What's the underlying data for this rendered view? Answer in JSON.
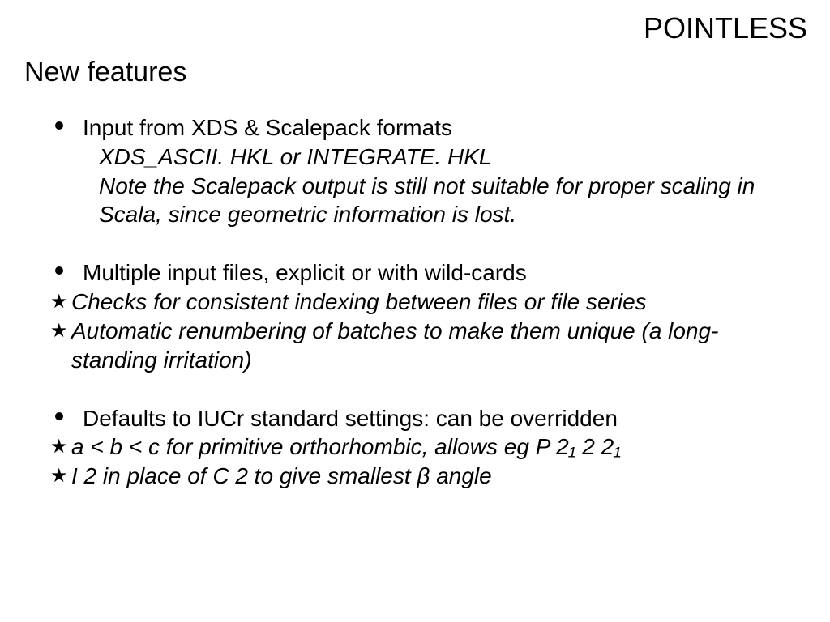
{
  "header": {
    "title_right": "POINTLESS",
    "subtitle": "New features"
  },
  "blocks": [
    {
      "bullet": "Input from XDS & Scalepack formats",
      "indented": [
        "XDS_ASCII. HKL or INTEGRATE. HKL",
        "Note the Scalepack output is still not suitable for proper scaling in Scala, since geometric information is lost."
      ],
      "stars": []
    },
    {
      "bullet": "Multiple input files, explicit or with wild-cards",
      "indented": [],
      "stars": [
        "Checks for consistent indexing between files or file series",
        "Automatic renumbering of batches to make them unique (a long-standing irritation)"
      ]
    },
    {
      "bullet": "Defaults to IUCr standard settings: can be overridden",
      "indented": [],
      "stars": [
        "a < b < c for primitive orthorhombic, allows eg P 2₁ 2 2₁",
        "I 2 in place of C 2 to give smallest β angle"
      ]
    }
  ],
  "star_glyph": "★"
}
